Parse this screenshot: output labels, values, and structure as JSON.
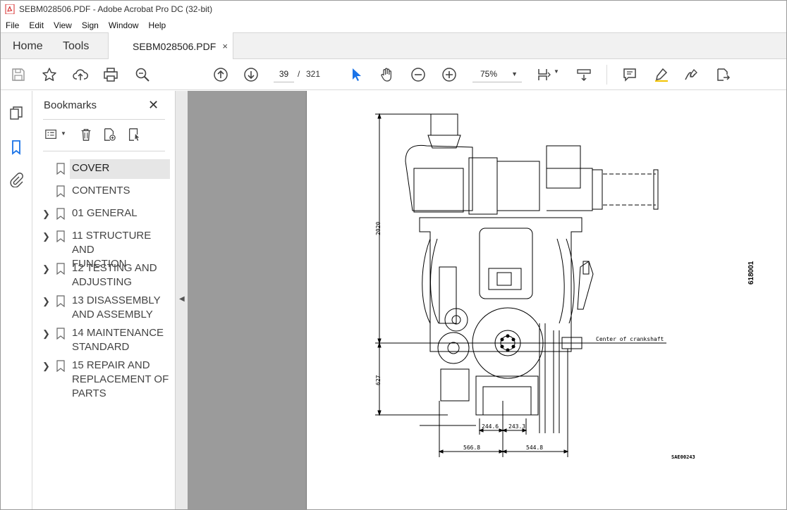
{
  "window": {
    "title": "SEBM028506.PDF - Adobe Acrobat Pro DC (32-bit)",
    "accent": "#d62a2a"
  },
  "menu": [
    "File",
    "Edit",
    "View",
    "Sign",
    "Window",
    "Help"
  ],
  "tabs": {
    "home": "Home",
    "tools": "Tools",
    "document": "SEBM028506.PDF",
    "close_glyph": "×"
  },
  "toolbar": {
    "current_page": "39",
    "page_separator": "/",
    "total_pages": "321",
    "zoom": "75%",
    "icons": [
      "save-icon",
      "bookmark-star-icon",
      "upload-icon",
      "print-icon",
      "find-zoom-icon",
      "prev-page-icon",
      "next-page-icon",
      "select-cursor-icon",
      "hand-icon",
      "zoom-out-icon",
      "zoom-in-icon",
      "zoom-dropdown",
      "fit-page-icon",
      "scroll-mode-icon",
      "comment-icon",
      "highlight-icon",
      "sign-icon",
      "share-icon"
    ]
  },
  "bookmarks": {
    "title": "Bookmarks",
    "close_glyph": "✕",
    "items": [
      {
        "label_lines": [
          "COVER"
        ],
        "expandable": false,
        "selected": true
      },
      {
        "label_lines": [
          "CONTENTS"
        ],
        "expandable": false,
        "selected": false
      },
      {
        "label_lines": [
          "01 GENERAL"
        ],
        "expandable": true,
        "selected": false
      },
      {
        "label_lines": [
          "11 STRUCTURE AND",
          "FUNCTION"
        ],
        "expandable": true,
        "selected": false
      },
      {
        "label_lines": [
          "12 TESTING AND",
          "ADJUSTING"
        ],
        "expandable": true,
        "selected": false
      },
      {
        "label_lines": [
          "13 DISASSEMBLY",
          "AND ASSEMBLY"
        ],
        "expandable": true,
        "selected": false
      },
      {
        "label_lines": [
          "14 MAINTENANCE",
          "STANDARD"
        ],
        "expandable": true,
        "selected": false
      },
      {
        "label_lines": [
          "15 REPAIR  AND",
          "REPLACEMENT OF",
          "PARTS"
        ],
        "expandable": true,
        "selected": false
      }
    ]
  },
  "drawing": {
    "height_total": "2020",
    "height_crank": "627",
    "dim_a": "244.6",
    "dim_b": "243.3",
    "dim_c": "566.8",
    "dim_d": "544.8",
    "crank_label": "Center of crankshaft",
    "side_code": "618001",
    "ref_code": "SAE00243"
  }
}
